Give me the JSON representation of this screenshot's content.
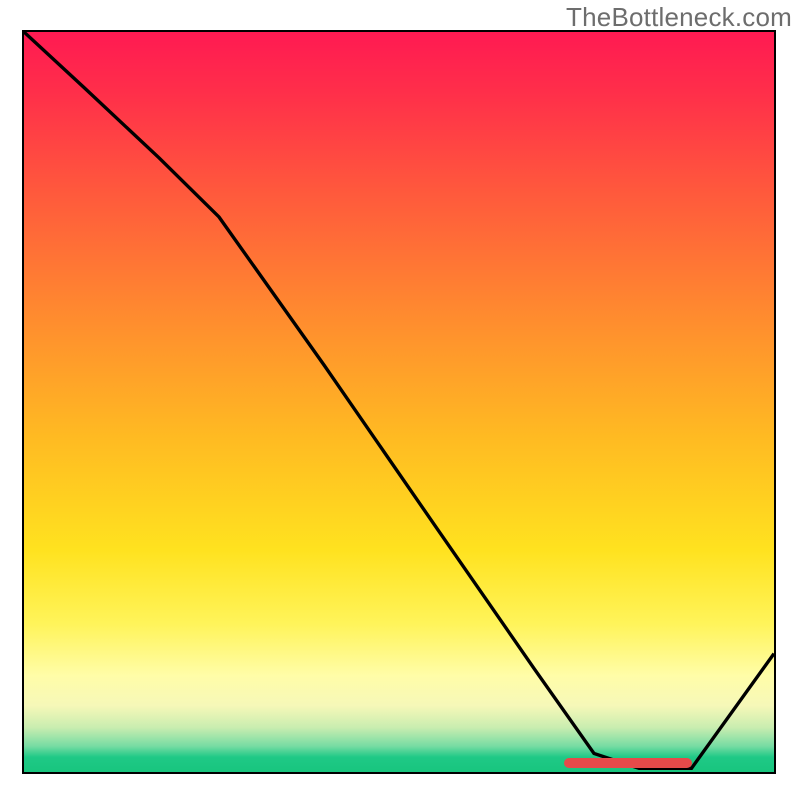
{
  "watermark": "TheBottleneck.com",
  "chart_data": {
    "type": "line",
    "title": "",
    "xlabel": "",
    "ylabel": "",
    "xlim": [
      0,
      100
    ],
    "ylim": [
      0,
      100
    ],
    "grid": false,
    "series": [
      {
        "name": "curve",
        "x": [
          0,
          8,
          18,
          26,
          40,
          55,
          68,
          76,
          82,
          89,
          100
        ],
        "y": [
          100,
          92.5,
          83,
          75,
          55,
          33,
          14,
          2.5,
          0.5,
          0.5,
          16
        ]
      }
    ],
    "marker": {
      "x_start": 72,
      "x_end": 89,
      "y": 0.6
    },
    "background_gradient_stops": [
      {
        "pct": 0,
        "color": "#ff1a52"
      },
      {
        "pct": 22,
        "color": "#ff5a3c"
      },
      {
        "pct": 55,
        "color": "#ffbb22"
      },
      {
        "pct": 80,
        "color": "#fff45a"
      },
      {
        "pct": 91,
        "color": "#f6f8b8"
      },
      {
        "pct": 98,
        "color": "#1fc986"
      }
    ]
  }
}
